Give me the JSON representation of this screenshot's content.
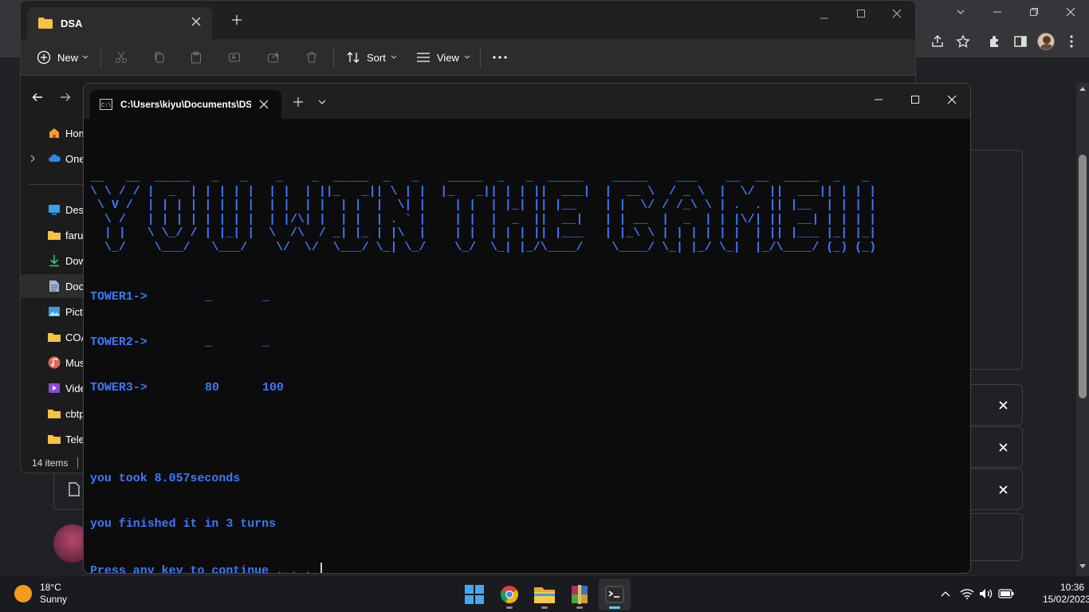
{
  "chrome": {
    "accent": "#3c4048"
  },
  "explorer": {
    "tab_title": "DSA",
    "toolbar": {
      "new_label": "New",
      "sort_label": "Sort",
      "view_label": "View"
    },
    "sidebar": [
      {
        "label": "Home",
        "icon": "home-icon"
      },
      {
        "label": "OneDrive",
        "icon": "cloud-icon"
      },
      {
        "label": "Desktop",
        "icon": "desktop-icon"
      },
      {
        "label": "faruk",
        "icon": "folder-icon"
      },
      {
        "label": "Downloads",
        "icon": "download-icon"
      },
      {
        "label": "Documents",
        "icon": "document-icon"
      },
      {
        "label": "Pictures",
        "icon": "picture-icon"
      },
      {
        "label": "COA",
        "icon": "folder-icon"
      },
      {
        "label": "Music",
        "icon": "music-icon"
      },
      {
        "label": "Videos",
        "icon": "video-icon"
      },
      {
        "label": "cbtp",
        "icon": "folder-icon"
      },
      {
        "label": "Telegram",
        "icon": "folder-icon"
      }
    ],
    "status": "14 items"
  },
  "terminal": {
    "tab_title": "C:\\Users\\kiyu\\Documents\\DSA",
    "banner": "__   __  _____   _   _    _    _  _____  _   _    _____  _   _  _____    _____    ___    __  __  _____  _   _ \n\\ \\ / / |  _  | | | | |  | |  | ||_   _|| \\ | |  |_   _|| | | ||  ___|  |  __ \\  / _ \\  |  \\/  ||  ___|| | | |\n \\ V /  | | | | | | | |  | |  | |  | |  |  \\| |    | |  | |_| || |__    | |  \\/ / /_\\ \\ | .  . || |__  | | | |\n  \\ /   | | | | | | | |  | |/\\| |  | |  | . ` |    | |  |  _  ||  __|   | | __  |  _  | | |\\/| ||  __| | | | |\n  | |   \\ \\_/ / | |_| |  \\  /\\  / _| |_ | |\\  |    | |  | | | || |___   | |_\\ \\ | | | | | |  | || |___ |_| |_|\n  \\_/    \\___/   \\___/    \\/  \\/  \\___/ \\_| \\_/    \\_/  \\_| |_/\\____/    \\____/ \\_| |_/ \\_|  |_/\\____/ (_) (_)",
    "towers": [
      {
        "label": "TOWER1->",
        "disk1": "_",
        "disk2": "_"
      },
      {
        "label": "TOWER2->",
        "disk1": "_",
        "disk2": "_"
      },
      {
        "label": "TOWER3->",
        "disk1": "80",
        "disk2": "100"
      }
    ],
    "time_line": "you took 8.057seconds",
    "turns_line": "you finished it in 3 turns",
    "prompt_line": "Press any key to continue . . . "
  },
  "taskbar": {
    "temperature": "18°C",
    "condition": "Sunny",
    "time": "10:36",
    "date": "15/02/2023",
    "colors": {
      "terminal_text": "#3b78ff",
      "active_indicator": "#60cdff"
    }
  }
}
